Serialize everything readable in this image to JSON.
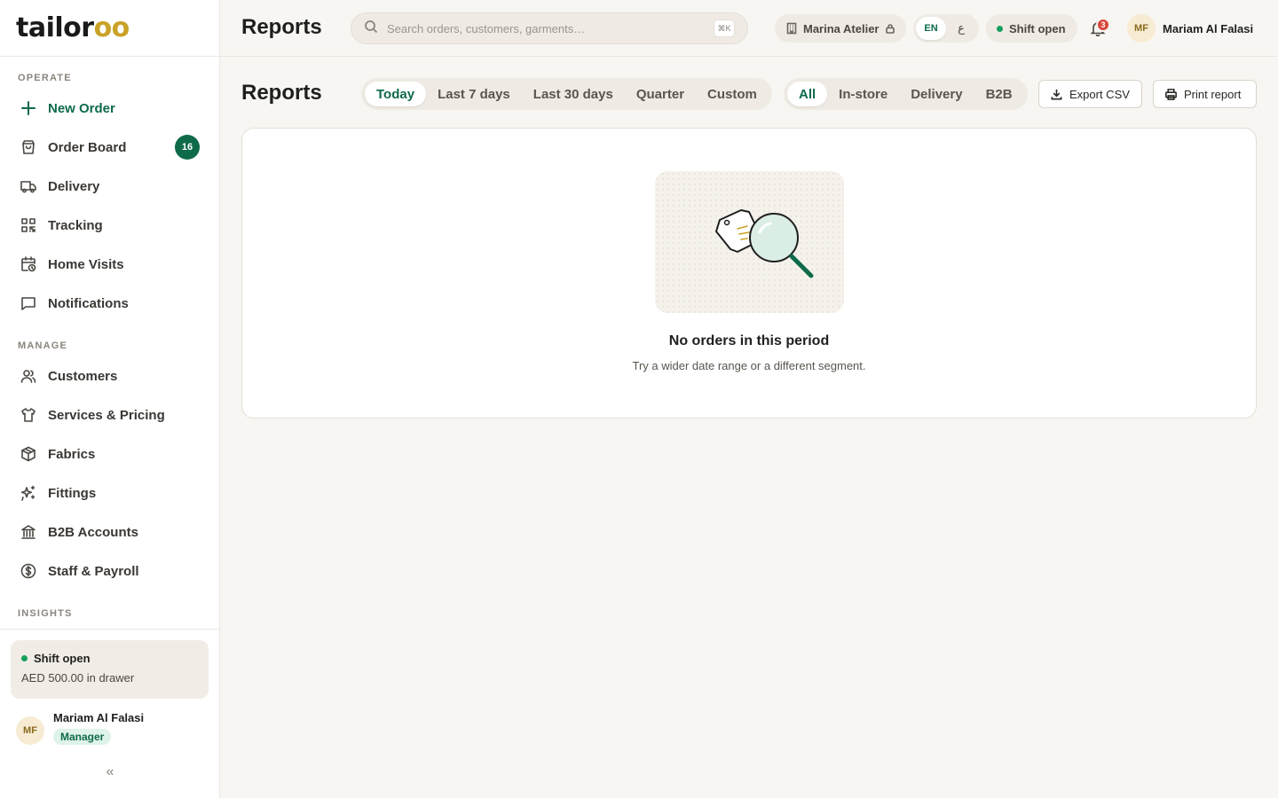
{
  "brand": {
    "logo_main": "tailor",
    "logo_accent": "oo"
  },
  "sidebar": {
    "sections": {
      "operate": "OPERATE",
      "manage": "MANAGE",
      "insights": "INSIGHTS"
    },
    "items": [
      {
        "label": "New Order",
        "icon": "plus-icon"
      },
      {
        "label": "Order Board",
        "icon": "bag-icon",
        "badge": "16"
      },
      {
        "label": "Delivery",
        "icon": "truck-icon"
      },
      {
        "label": "Tracking",
        "icon": "qr-icon"
      },
      {
        "label": "Home Visits",
        "icon": "calendar-clock-icon"
      },
      {
        "label": "Notifications",
        "icon": "message-icon"
      },
      {
        "label": "Customers",
        "icon": "users-icon"
      },
      {
        "label": "Services & Pricing",
        "icon": "shirt-icon"
      },
      {
        "label": "Fabrics",
        "icon": "box-icon"
      },
      {
        "label": "Fittings",
        "icon": "sparkles-icon"
      },
      {
        "label": "B2B Accounts",
        "icon": "bank-icon"
      },
      {
        "label": "Staff & Payroll",
        "icon": "dollar-circle-icon"
      }
    ],
    "shift": {
      "status": "Shift open",
      "drawer": "AED 500.00 in drawer"
    },
    "user": {
      "initials": "MF",
      "name": "Mariam Al Falasi",
      "role": "Manager"
    },
    "collapse_glyph": "«"
  },
  "topbar": {
    "title": "Reports",
    "search": {
      "placeholder": "Search orders, customers, garments…",
      "shortcut": "⌘K"
    },
    "branch": "Marina Atelier",
    "language": {
      "en": "EN",
      "ar": "ع",
      "active": "EN"
    },
    "shift_status": "Shift open",
    "notifications_count": "3",
    "user": {
      "initials": "MF",
      "name": "Mariam Al Falasi"
    }
  },
  "main": {
    "title": "Reports",
    "periods": [
      "Today",
      "Last 7 days",
      "Last 30 days",
      "Quarter",
      "Custom"
    ],
    "active_period": "Today",
    "segments": [
      "All",
      "In-store",
      "Delivery",
      "B2B"
    ],
    "active_segment": "All",
    "export_label": "Export CSV",
    "print_label": "Print report",
    "empty": {
      "title": "No orders in this period",
      "subtitle": "Try a wider date range or a different segment."
    }
  },
  "colors": {
    "brand_green": "#0e6b4a",
    "accent_gold": "#c9a227",
    "status_green": "#14a05c",
    "alert_red": "#d8483a",
    "background": "#f8f6f2"
  }
}
